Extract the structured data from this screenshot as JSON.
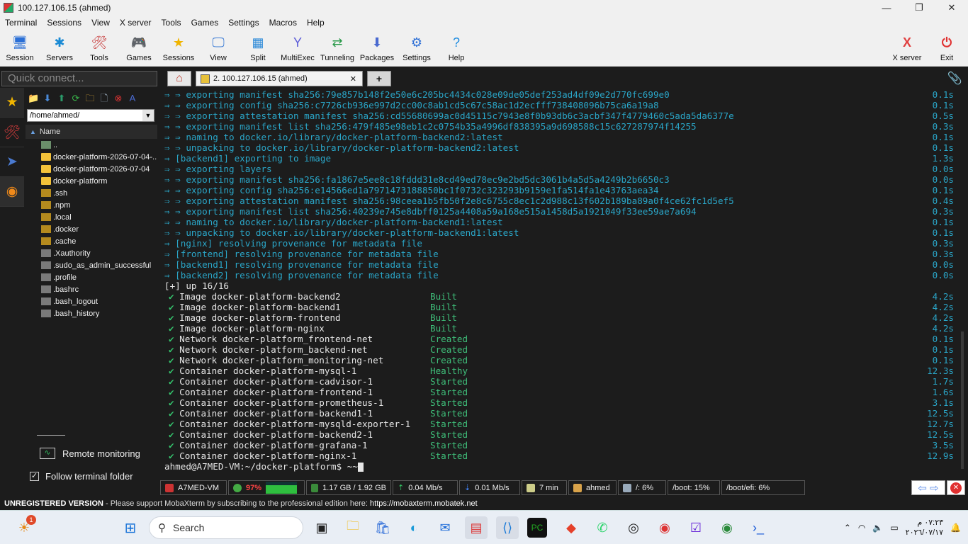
{
  "window": {
    "title": "100.127.106.15 (ahmed)",
    "minimize": "—",
    "maximize": "❐",
    "close": "✕"
  },
  "menu": [
    "Terminal",
    "Sessions",
    "View",
    "X server",
    "Tools",
    "Games",
    "Settings",
    "Macros",
    "Help"
  ],
  "toolbar": {
    "items": [
      {
        "label": "Session",
        "icon": "session-icon",
        "glyph": "🖥",
        "color": "#2a6fd6"
      },
      {
        "label": "Servers",
        "icon": "servers-icon",
        "glyph": "✱",
        "color": "#1a8ad4"
      },
      {
        "label": "Tools",
        "icon": "tools-icon",
        "glyph": "🛠",
        "color": "#c73a3a"
      },
      {
        "label": "Games",
        "icon": "games-icon",
        "glyph": "🎮",
        "color": "#555"
      },
      {
        "label": "Sessions",
        "icon": "star-icon",
        "glyph": "★",
        "color": "#f0b400"
      },
      {
        "label": "View",
        "icon": "view-icon",
        "glyph": "🖵",
        "color": "#3a7bd5"
      },
      {
        "label": "Split",
        "icon": "split-icon",
        "glyph": "▦",
        "color": "#2d8ad8"
      },
      {
        "label": "MultiExec",
        "icon": "multiexec-icon",
        "glyph": "Y",
        "color": "#5a5ad8"
      },
      {
        "label": "Tunneling",
        "icon": "tunneling-icon",
        "glyph": "⇄",
        "color": "#2a9a4a"
      },
      {
        "label": "Packages",
        "icon": "packages-icon",
        "glyph": "⬇",
        "color": "#4a6ad0"
      },
      {
        "label": "Settings",
        "icon": "settings-icon",
        "glyph": "⚙",
        "color": "#2d6fd6"
      },
      {
        "label": "Help",
        "icon": "help-icon",
        "glyph": "?",
        "color": "#1a8ae0"
      }
    ],
    "xserver": {
      "label": "X server",
      "glyph": "X",
      "color": "#e04040"
    },
    "exit": {
      "label": "Exit",
      "glyph": "⏻",
      "color": "#e03030"
    }
  },
  "quick_connect": {
    "placeholder": "Quick connect..."
  },
  "tabs": {
    "home_glyph": "⌂",
    "active_label": "2. 100.127.106.15 (ahmed)",
    "close": "✕",
    "add": "+"
  },
  "file_browser": {
    "path": "/home/ahmed/",
    "column": "Name",
    "items": [
      {
        "name": "..",
        "type": "up"
      },
      {
        "name": "docker-platform-2026-07-04-...",
        "type": "folder"
      },
      {
        "name": "docker-platform-2026-07-04",
        "type": "folder"
      },
      {
        "name": "docker-platform",
        "type": "folder"
      },
      {
        "name": ".ssh",
        "type": "dot"
      },
      {
        "name": ".npm",
        "type": "dot"
      },
      {
        "name": ".local",
        "type": "dot"
      },
      {
        "name": ".docker",
        "type": "dot"
      },
      {
        "name": ".cache",
        "type": "dot"
      },
      {
        "name": ".Xauthority",
        "type": "file"
      },
      {
        "name": ".sudo_as_admin_successful",
        "type": "file"
      },
      {
        "name": ".profile",
        "type": "file"
      },
      {
        "name": ".bashrc",
        "type": "file"
      },
      {
        "name": ".bash_logout",
        "type": "file"
      },
      {
        "name": ".bash_history",
        "type": "file"
      }
    ],
    "remote_monitoring": "Remote monitoring",
    "follow_terminal": "Follow terminal folder",
    "follow_checked": true
  },
  "terminal": {
    "progress_lines": [
      {
        "text": "⇒ ⇒ exporting manifest sha256:79e857b148f2e50e6c205bc4434c028e09de05def253ad4df09e2d770fc699e0",
        "time": "0.1s"
      },
      {
        "text": "⇒ ⇒ exporting config sha256:c7726cb936e997d2cc00c8ab1cd5c67c58ac1d2ecfff738408096b75ca6a19a8",
        "time": "0.1s"
      },
      {
        "text": "⇒ ⇒ exporting attestation manifest sha256:cd55680699ac0d45115c7943e8f0b93db6c3acbf347f4779460c5ada5da6377e",
        "time": "0.5s"
      },
      {
        "text": "⇒ ⇒ exporting manifest list sha256:479f485e98eb1c2c0754b35a4996df838395a9d698588c15c627287974f14255",
        "time": "0.3s"
      },
      {
        "text": "⇒ ⇒ naming to docker.io/library/docker-platform-backend2:latest",
        "time": "0.1s"
      },
      {
        "text": "⇒ ⇒ unpacking to docker.io/library/docker-platform-backend2:latest",
        "time": "0.1s"
      },
      {
        "text": "⇒ [backend1] exporting to image",
        "time": "1.3s"
      },
      {
        "text": "⇒ ⇒ exporting layers",
        "time": "0.0s"
      },
      {
        "text": "⇒ ⇒ exporting manifest sha256:fa1867e5ee8c18fddd31e8cd49ed78ec9e2bd5dc3061b4a5d5a4249b2b6650c3",
        "time": "0.0s"
      },
      {
        "text": "⇒ ⇒ exporting config sha256:e14566ed1a7971473188850bc1f0732c323293b9159e1fa514fa1e43763aea34",
        "time": "0.1s"
      },
      {
        "text": "⇒ ⇒ exporting attestation manifest sha256:98ceea1b5fb50f2e8c6755c8ec1c2d988c13f602b189ba89a0f4ce62fc1d5ef5",
        "time": "0.4s"
      },
      {
        "text": "⇒ ⇒ exporting manifest list sha256:40239e745e8dbff0125a4408a59a168e515a1458d5a1921049f33ee59ae7a694",
        "time": "0.3s"
      },
      {
        "text": "⇒ ⇒ naming to docker.io/library/docker-platform-backend1:latest",
        "time": "0.1s"
      },
      {
        "text": "⇒ ⇒ unpacking to docker.io/library/docker-platform-backend1:latest",
        "time": "0.1s"
      },
      {
        "text": "⇒ [nginx] resolving provenance for metadata file",
        "time": "0.3s"
      },
      {
        "text": "⇒ [frontend] resolving provenance for metadata file",
        "time": "0.3s"
      },
      {
        "text": "⇒ [backend1] resolving provenance for metadata file",
        "time": "0.0s"
      },
      {
        "text": "⇒ [backend2] resolving provenance for metadata file",
        "time": "0.0s"
      }
    ],
    "up_line": "[+] up 16/16",
    "results": [
      {
        "name": "✔ Image docker-platform-backend2",
        "status": "Built",
        "time": "4.2s"
      },
      {
        "name": "✔ Image docker-platform-backend1",
        "status": "Built",
        "time": "4.2s"
      },
      {
        "name": "✔ Image docker-platform-frontend",
        "status": "Built",
        "time": "4.2s"
      },
      {
        "name": "✔ Image docker-platform-nginx",
        "status": "Built",
        "time": "4.2s"
      },
      {
        "name": "✔ Network docker-platform_frontend-net",
        "status": "Created",
        "time": "0.1s"
      },
      {
        "name": "✔ Network docker-platform_backend-net",
        "status": "Created",
        "time": "0.1s"
      },
      {
        "name": "✔ Network docker-platform_monitoring-net",
        "status": "Created",
        "time": "0.1s"
      },
      {
        "name": "✔ Container docker-platform-mysql-1",
        "status": "Healthy",
        "time": "12.3s"
      },
      {
        "name": "✔ Container docker-platform-cadvisor-1",
        "status": "Started",
        "time": "1.7s"
      },
      {
        "name": "✔ Container docker-platform-frontend-1",
        "status": "Started",
        "time": "1.6s"
      },
      {
        "name": "✔ Container docker-platform-prometheus-1",
        "status": "Started",
        "time": "3.1s"
      },
      {
        "name": "✔ Container docker-platform-backend1-1",
        "status": "Started",
        "time": "12.5s"
      },
      {
        "name": "✔ Container docker-platform-mysqld-exporter-1",
        "status": "Started",
        "time": "12.7s"
      },
      {
        "name": "✔ Container docker-platform-backend2-1",
        "status": "Started",
        "time": "12.5s"
      },
      {
        "name": "✔ Container docker-platform-grafana-1",
        "status": "Started",
        "time": "3.5s"
      },
      {
        "name": "✔ Container docker-platform-nginx-1",
        "status": "Started",
        "time": "12.9s"
      }
    ],
    "prompt": "ahmed@A7MED-VM:~/docker-platform$ ~~"
  },
  "statusbar": {
    "host": "A7MED-VM",
    "cpu": "97%",
    "memory": "1.17 GB / 1.92 GB",
    "upload": "0.04 Mb/s",
    "download": "0.01 Mb/s",
    "uptime": "7 min",
    "user": "ahmed",
    "disk_root": "/: 6%",
    "disk_boot": "/boot: 15%",
    "disk_efi": "/boot/efi: 6%"
  },
  "unregistered": {
    "label": "UNREGISTERED VERSION",
    "message": "  -  Please support MobaXterm by subscribing to the professional edition here:  ",
    "link": "https://mobaxterm.mobatek.net"
  },
  "taskbar": {
    "search_placeholder": "Search",
    "notification_badge": "1",
    "clock_time": "٠٧:٢٣ م",
    "clock_date": "٢٠٢٦/٠٧/١٧"
  }
}
